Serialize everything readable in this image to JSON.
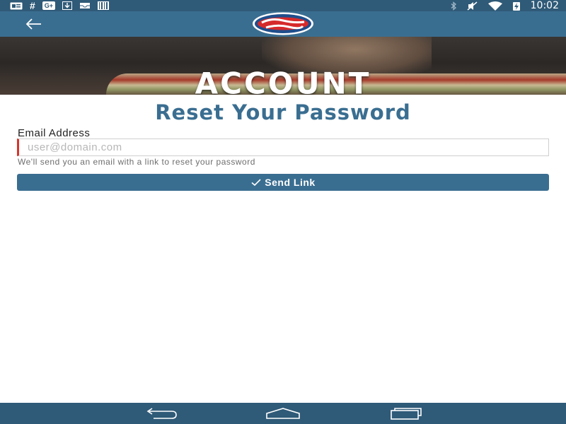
{
  "status_bar": {
    "time": "10:02",
    "left_icons": [
      "notification-card-icon",
      "hashtag-icon",
      "google-plus-icon",
      "download-icon",
      "inbox-icon",
      "barcode-icon"
    ],
    "right_icons": [
      "bluetooth-icon",
      "mute-icon",
      "wifi-icon",
      "battery-charging-icon"
    ],
    "gplus_text": "G+",
    "hash_text": "#"
  },
  "app_bar": {
    "background": "#3a6e91",
    "back_icon": "arrow-left-icon"
  },
  "hero": {
    "title": "ACCOUNT"
  },
  "reset_form": {
    "title": "Reset Your Password",
    "email_label": "Email Address",
    "email_placeholder": "user@domain.com",
    "email_value": "",
    "help_text": "We'll send you an email with a link to reset your password",
    "send_button_label": "Send Link",
    "send_button_icon": "check-icon",
    "accent_color": "#3a6e91",
    "error_color": "#d9342b"
  },
  "nav_bar": {
    "buttons": [
      "back-nav-icon",
      "home-nav-icon",
      "recents-nav-icon"
    ]
  }
}
